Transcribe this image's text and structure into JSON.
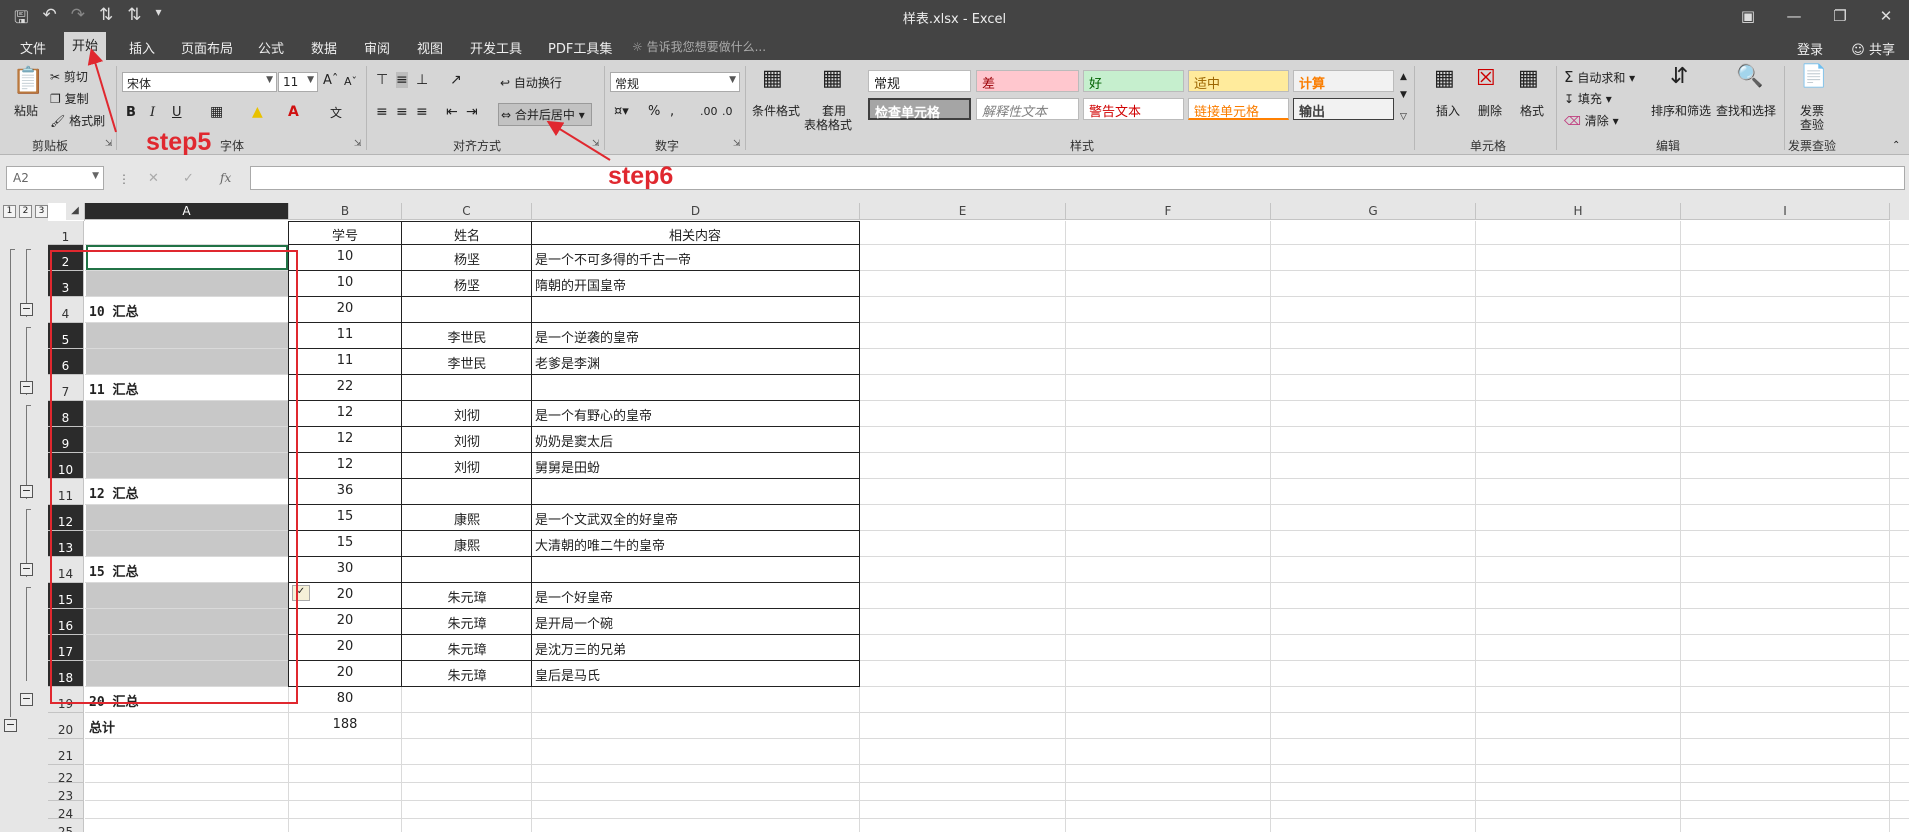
{
  "window": {
    "title": "样表.xlsx - Excel"
  },
  "menu": {
    "tabs": [
      "文件",
      "开始",
      "插入",
      "页面布局",
      "公式",
      "数据",
      "审阅",
      "视图",
      "开发工具",
      "PDF工具集"
    ],
    "tell_me": "告诉我您想要做什么...",
    "login": "登录",
    "share": "共享"
  },
  "ribbon": {
    "clipboard": {
      "paste": "粘贴",
      "cut": "剪切",
      "copy": "复制",
      "format_painter": "格式刷",
      "label": "剪贴板"
    },
    "font": {
      "name": "宋体",
      "size": "11",
      "label": "字体"
    },
    "alignment": {
      "wrap": "自动换行",
      "merge": "合并后居中",
      "label": "对齐方式"
    },
    "number": {
      "format": "常规",
      "label": "数字"
    },
    "styles": {
      "conditional": "条件格式",
      "table_format_1": "套用",
      "table_format_2": "表格格式",
      "cells": [
        "常规",
        "差",
        "好",
        "适中",
        "计算",
        "检查单元格",
        "解释性文本",
        "警告文本",
        "链接单元格",
        "输出"
      ],
      "label": "样式"
    },
    "cells": {
      "insert": "插入",
      "delete": "删除",
      "format": "格式",
      "label": "单元格"
    },
    "editing": {
      "autosum": "自动求和",
      "fill": "填充",
      "clear": "清除",
      "sort": "排序和筛选",
      "find": "查找和选择",
      "label": "编辑"
    },
    "invoice": {
      "check_1": "发票",
      "check_2": "查验",
      "label": "发票查验"
    }
  },
  "formula_bar": {
    "name_box": "A2",
    "fx": "fx",
    "content": ""
  },
  "sheet": {
    "columns": [
      "A",
      "B",
      "C",
      "D",
      "E",
      "F",
      "G",
      "H",
      "I"
    ],
    "outline_levels": [
      "1",
      "2",
      "3"
    ],
    "rows": [
      {
        "n": "1",
        "a": "",
        "b": "学号",
        "c": "姓名",
        "d": "相关内容"
      },
      {
        "n": "2",
        "a": "",
        "b": "10",
        "c": "杨坚",
        "d": "是一个不可多得的千古一帝"
      },
      {
        "n": "3",
        "a": "",
        "b": "10",
        "c": "杨坚",
        "d": "隋朝的开国皇帝"
      },
      {
        "n": "4",
        "a": "10 汇总",
        "b": "20",
        "c": "",
        "d": ""
      },
      {
        "n": "5",
        "a": "",
        "b": "11",
        "c": "李世民",
        "d": "是一个逆袭的皇帝"
      },
      {
        "n": "6",
        "a": "",
        "b": "11",
        "c": "李世民",
        "d": "老爹是李渊"
      },
      {
        "n": "7",
        "a": "11 汇总",
        "b": "22",
        "c": "",
        "d": ""
      },
      {
        "n": "8",
        "a": "",
        "b": "12",
        "c": "刘彻",
        "d": "是一个有野心的皇帝"
      },
      {
        "n": "9",
        "a": "",
        "b": "12",
        "c": "刘彻",
        "d": "奶奶是窦太后"
      },
      {
        "n": "10",
        "a": "",
        "b": "12",
        "c": "刘彻",
        "d": "舅舅是田蚡"
      },
      {
        "n": "11",
        "a": "12 汇总",
        "b": "36",
        "c": "",
        "d": ""
      },
      {
        "n": "12",
        "a": "",
        "b": "15",
        "c": "康熙",
        "d": "是一个文武双全的好皇帝"
      },
      {
        "n": "13",
        "a": "",
        "b": "15",
        "c": "康熙",
        "d": "大清朝的唯二牛的皇帝"
      },
      {
        "n": "14",
        "a": "15 汇总",
        "b": "30",
        "c": "",
        "d": ""
      },
      {
        "n": "15",
        "a": "",
        "b": "20",
        "c": "朱元璋",
        "d": "是一个好皇帝"
      },
      {
        "n": "16",
        "a": "",
        "b": "20",
        "c": "朱元璋",
        "d": "是开局一个碗"
      },
      {
        "n": "17",
        "a": "",
        "b": "20",
        "c": "朱元璋",
        "d": "是沈万三的兄弟"
      },
      {
        "n": "18",
        "a": "",
        "b": "20",
        "c": "朱元璋",
        "d": "皇后是马氏"
      },
      {
        "n": "19",
        "a": "20 汇总",
        "b": "80",
        "c": "",
        "d": ""
      },
      {
        "n": "20",
        "a": "总计",
        "b": "188",
        "c": "",
        "d": ""
      },
      {
        "n": "21",
        "a": "",
        "b": "",
        "c": "",
        "d": ""
      },
      {
        "n": "22",
        "a": "",
        "b": "",
        "c": "",
        "d": ""
      },
      {
        "n": "23",
        "a": "",
        "b": "",
        "c": "",
        "d": ""
      },
      {
        "n": "24",
        "a": "",
        "b": "",
        "c": "",
        "d": ""
      },
      {
        "n": "25",
        "a": "",
        "b": "",
        "c": "",
        "d": ""
      }
    ]
  },
  "annotations": {
    "step5": "step5",
    "step6": "step6"
  },
  "colors": {
    "annotation": "#e0282f",
    "title_bar": "#444444"
  }
}
